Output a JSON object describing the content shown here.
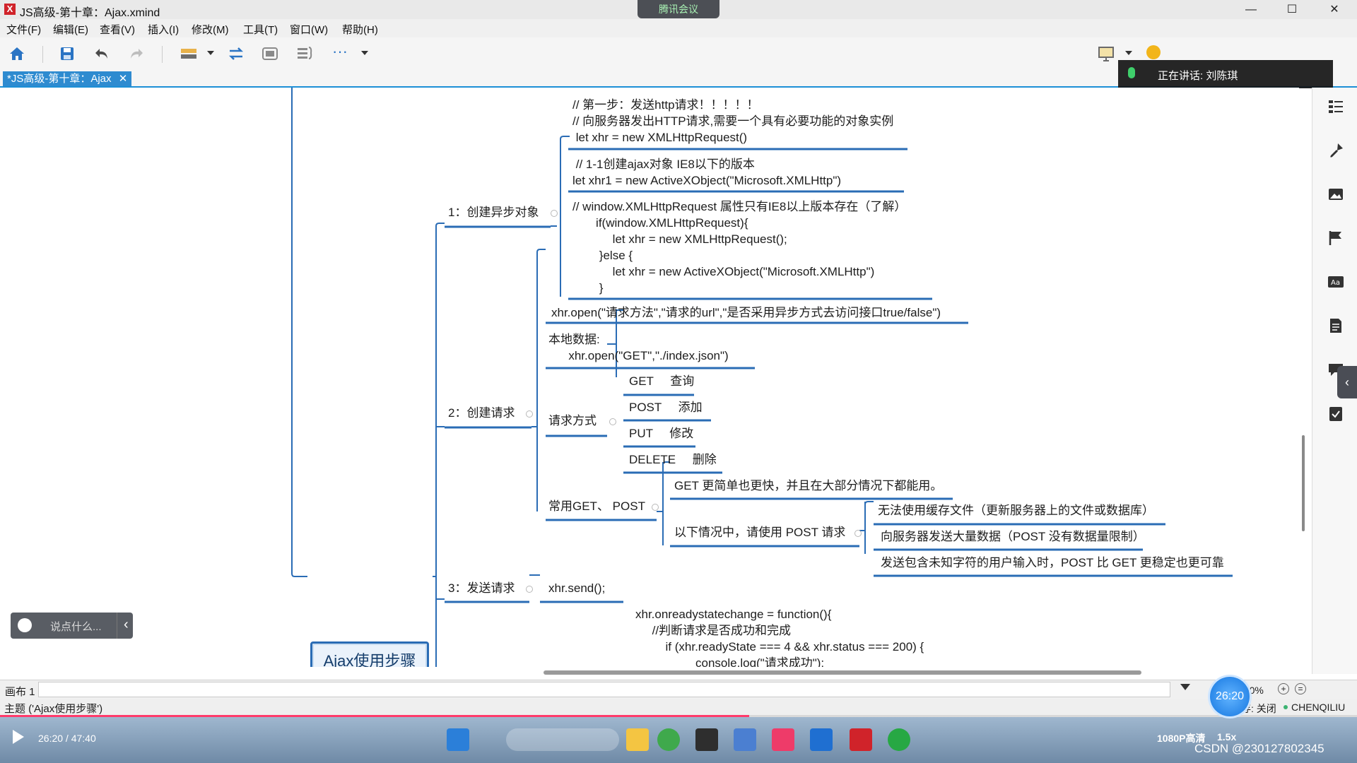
{
  "window": {
    "title": "JS高级-第十章：Ajax.xmind",
    "app_icon_glyph": "X",
    "minimize": "—",
    "maximize": "☐",
    "close": "✕"
  },
  "meeting": {
    "badge": "腾讯会议",
    "speaking": "正在讲话: 刘陈琪"
  },
  "menu": [
    "文件(F)",
    "编辑(E)",
    "查看(V)",
    "插入(I)",
    "修改(M)",
    "工具(T)",
    "窗口(W)",
    "帮助(H)"
  ],
  "tab": {
    "label": "*JS高级-第十章：Ajax",
    "close": "✕"
  },
  "mindmap": {
    "central": "Ajax使用步骤",
    "branch1": {
      "label": "1：创建异步对象",
      "node1": "// 第一步：发送http请求！！！！！\n// 向服务器发出HTTP请求,需要一个具有必要功能的对象实例\n let xhr = new XMLHttpRequest()",
      "node2": " // 1-1创建ajax对象 IE8以下的版本\nlet xhr1 = new ActiveXObject(\"Microsoft.XMLHttp\")",
      "node3": "// window.XMLHttpRequest 属性只有IE8以上版本存在（了解）\n       if(window.XMLHttpRequest){\n            let xhr = new XMLHttpRequest();\n        }else {\n            let xhr = new ActiveXObject(\"Microsoft.XMLHttp\")\n        }"
    },
    "branch2": {
      "label": "2：创建请求",
      "open": "xhr.open(\"请求方法\",\"请求的url\",\"是否采用异步方式去访问接口true/false\")",
      "local": "本地数据:\n      xhr.open(\"GET\",\"./index.json\")",
      "methods_label": "请求方式",
      "methods": [
        "GET     查询",
        "POST     添加",
        "PUT     修改",
        "DELETE     删除"
      ],
      "common_label": "常用GET、 POST",
      "get_note": "GET 更简单也更快，并且在大部分情况下都能用。",
      "post_label": "以下情况中，请使用 POST 请求",
      "post_cases": [
        "无法使用缓存文件（更新服务器上的文件或数据库）",
        "向服务器发送大量数据（POST 没有数据量限制）",
        "发送包含未知字符的用户输入时，POST 比 GET 更稳定也更可靠"
      ]
    },
    "branch3": {
      "label": "3：发送请求",
      "send": "xhr.send();"
    },
    "branch4": {
      "code": "xhr.onreadystatechange = function(){\n     //判断请求是否成功和完成\n         if (xhr.readyState === 4 && xhr.status === 200) {\n                  console.log(\"请求成功\");"
    }
  },
  "chat": {
    "placeholder": "说点什么...",
    "arrow": "‹"
  },
  "status": {
    "sheet": "画布 1",
    "zoom": "100%",
    "topic": "主题 ('Ajax使用步骤')",
    "autosave": "存: 关闭",
    "user": "CHENQILIU"
  },
  "player": {
    "time": "26:20  /  47:40",
    "bubble_time": "26:20",
    "quality": "1080P高清",
    "speed": "1.5x",
    "watermark": "CSDN @230127802345"
  },
  "colors": {
    "accent": "#1c8fd6",
    "branch_line": "#2a6cb5",
    "central_border": "#2a6cb5"
  }
}
